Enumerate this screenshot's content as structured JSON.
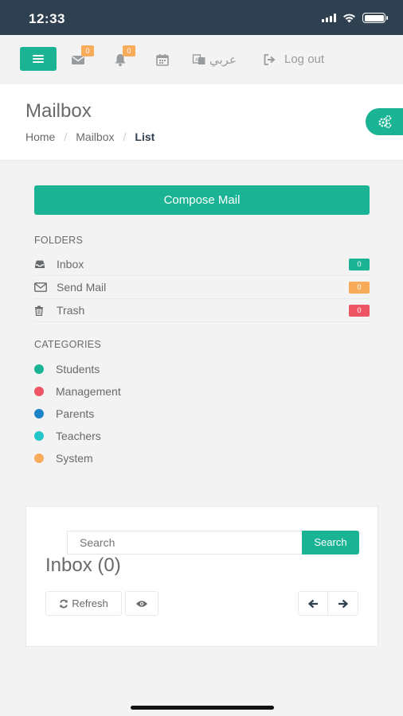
{
  "status_bar": {
    "time": "12:33"
  },
  "topnav": {
    "mail_badge": "0",
    "bell_badge": "0",
    "language": "عربي",
    "logout": "Log out"
  },
  "heading": {
    "title": "Mailbox",
    "breadcrumb": [
      "Home",
      "Mailbox",
      "List"
    ]
  },
  "sidebar": {
    "compose": "Compose Mail",
    "folders_title": "FOLDERS",
    "folders": [
      {
        "label": "Inbox",
        "count": "0",
        "color": "#1ab394",
        "icon": "inbox-icon"
      },
      {
        "label": "Send Mail",
        "count": "0",
        "color": "#f8ac59",
        "icon": "envelope-icon"
      },
      {
        "label": "Trash",
        "count": "0",
        "color": "#ed5565",
        "icon": "trash-icon"
      }
    ],
    "categories_title": "CATEGORIES",
    "categories": [
      {
        "label": "Students",
        "color": "#1ab394"
      },
      {
        "label": "Management",
        "color": "#ed5565"
      },
      {
        "label": "Parents",
        "color": "#1c84c6"
      },
      {
        "label": "Teachers",
        "color": "#23c6c8"
      },
      {
        "label": "System",
        "color": "#f8ac59"
      }
    ]
  },
  "mailbox": {
    "search_placeholder": "Search",
    "search_button": "Search",
    "title": "Inbox (0)",
    "refresh": "Refresh"
  },
  "colors": {
    "primary": "#1ab394",
    "warning": "#f8ac59",
    "danger": "#ed5565",
    "statusbar": "#2f4050"
  }
}
